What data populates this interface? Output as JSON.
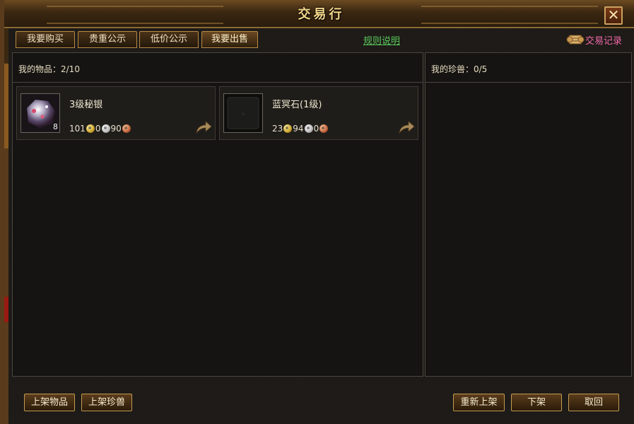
{
  "window": {
    "title": "交易行",
    "close_label": "✕"
  },
  "tabs": [
    {
      "label": "我要购买",
      "active": false
    },
    {
      "label": "贵重公示",
      "active": false
    },
    {
      "label": "低价公示",
      "active": false
    },
    {
      "label": "我要出售",
      "active": true
    }
  ],
  "rules_link": "规则说明",
  "record_link": "交易记录",
  "items_panel": {
    "title": "我的物品：2/10",
    "items": [
      {
        "name": "3级秘银",
        "quantity": "8",
        "gold": "101",
        "silver": "0",
        "copper": "90"
      },
      {
        "name": "蓝冥石(1级)",
        "quantity": "",
        "gold": "23",
        "silver": "94",
        "copper": "0"
      }
    ]
  },
  "pets_panel": {
    "title": "我的珍兽：0/5"
  },
  "buttons": {
    "list_item": "上架物品",
    "list_pet": "上架珍兽",
    "relist": "重新上架",
    "unlist": "下架",
    "cancel": "取回"
  },
  "colors": {
    "title_gold": "#f4d88a",
    "rules_green": "#5ac85a",
    "record_pink": "#f06aa8",
    "border_bronze": "#c49a52"
  }
}
